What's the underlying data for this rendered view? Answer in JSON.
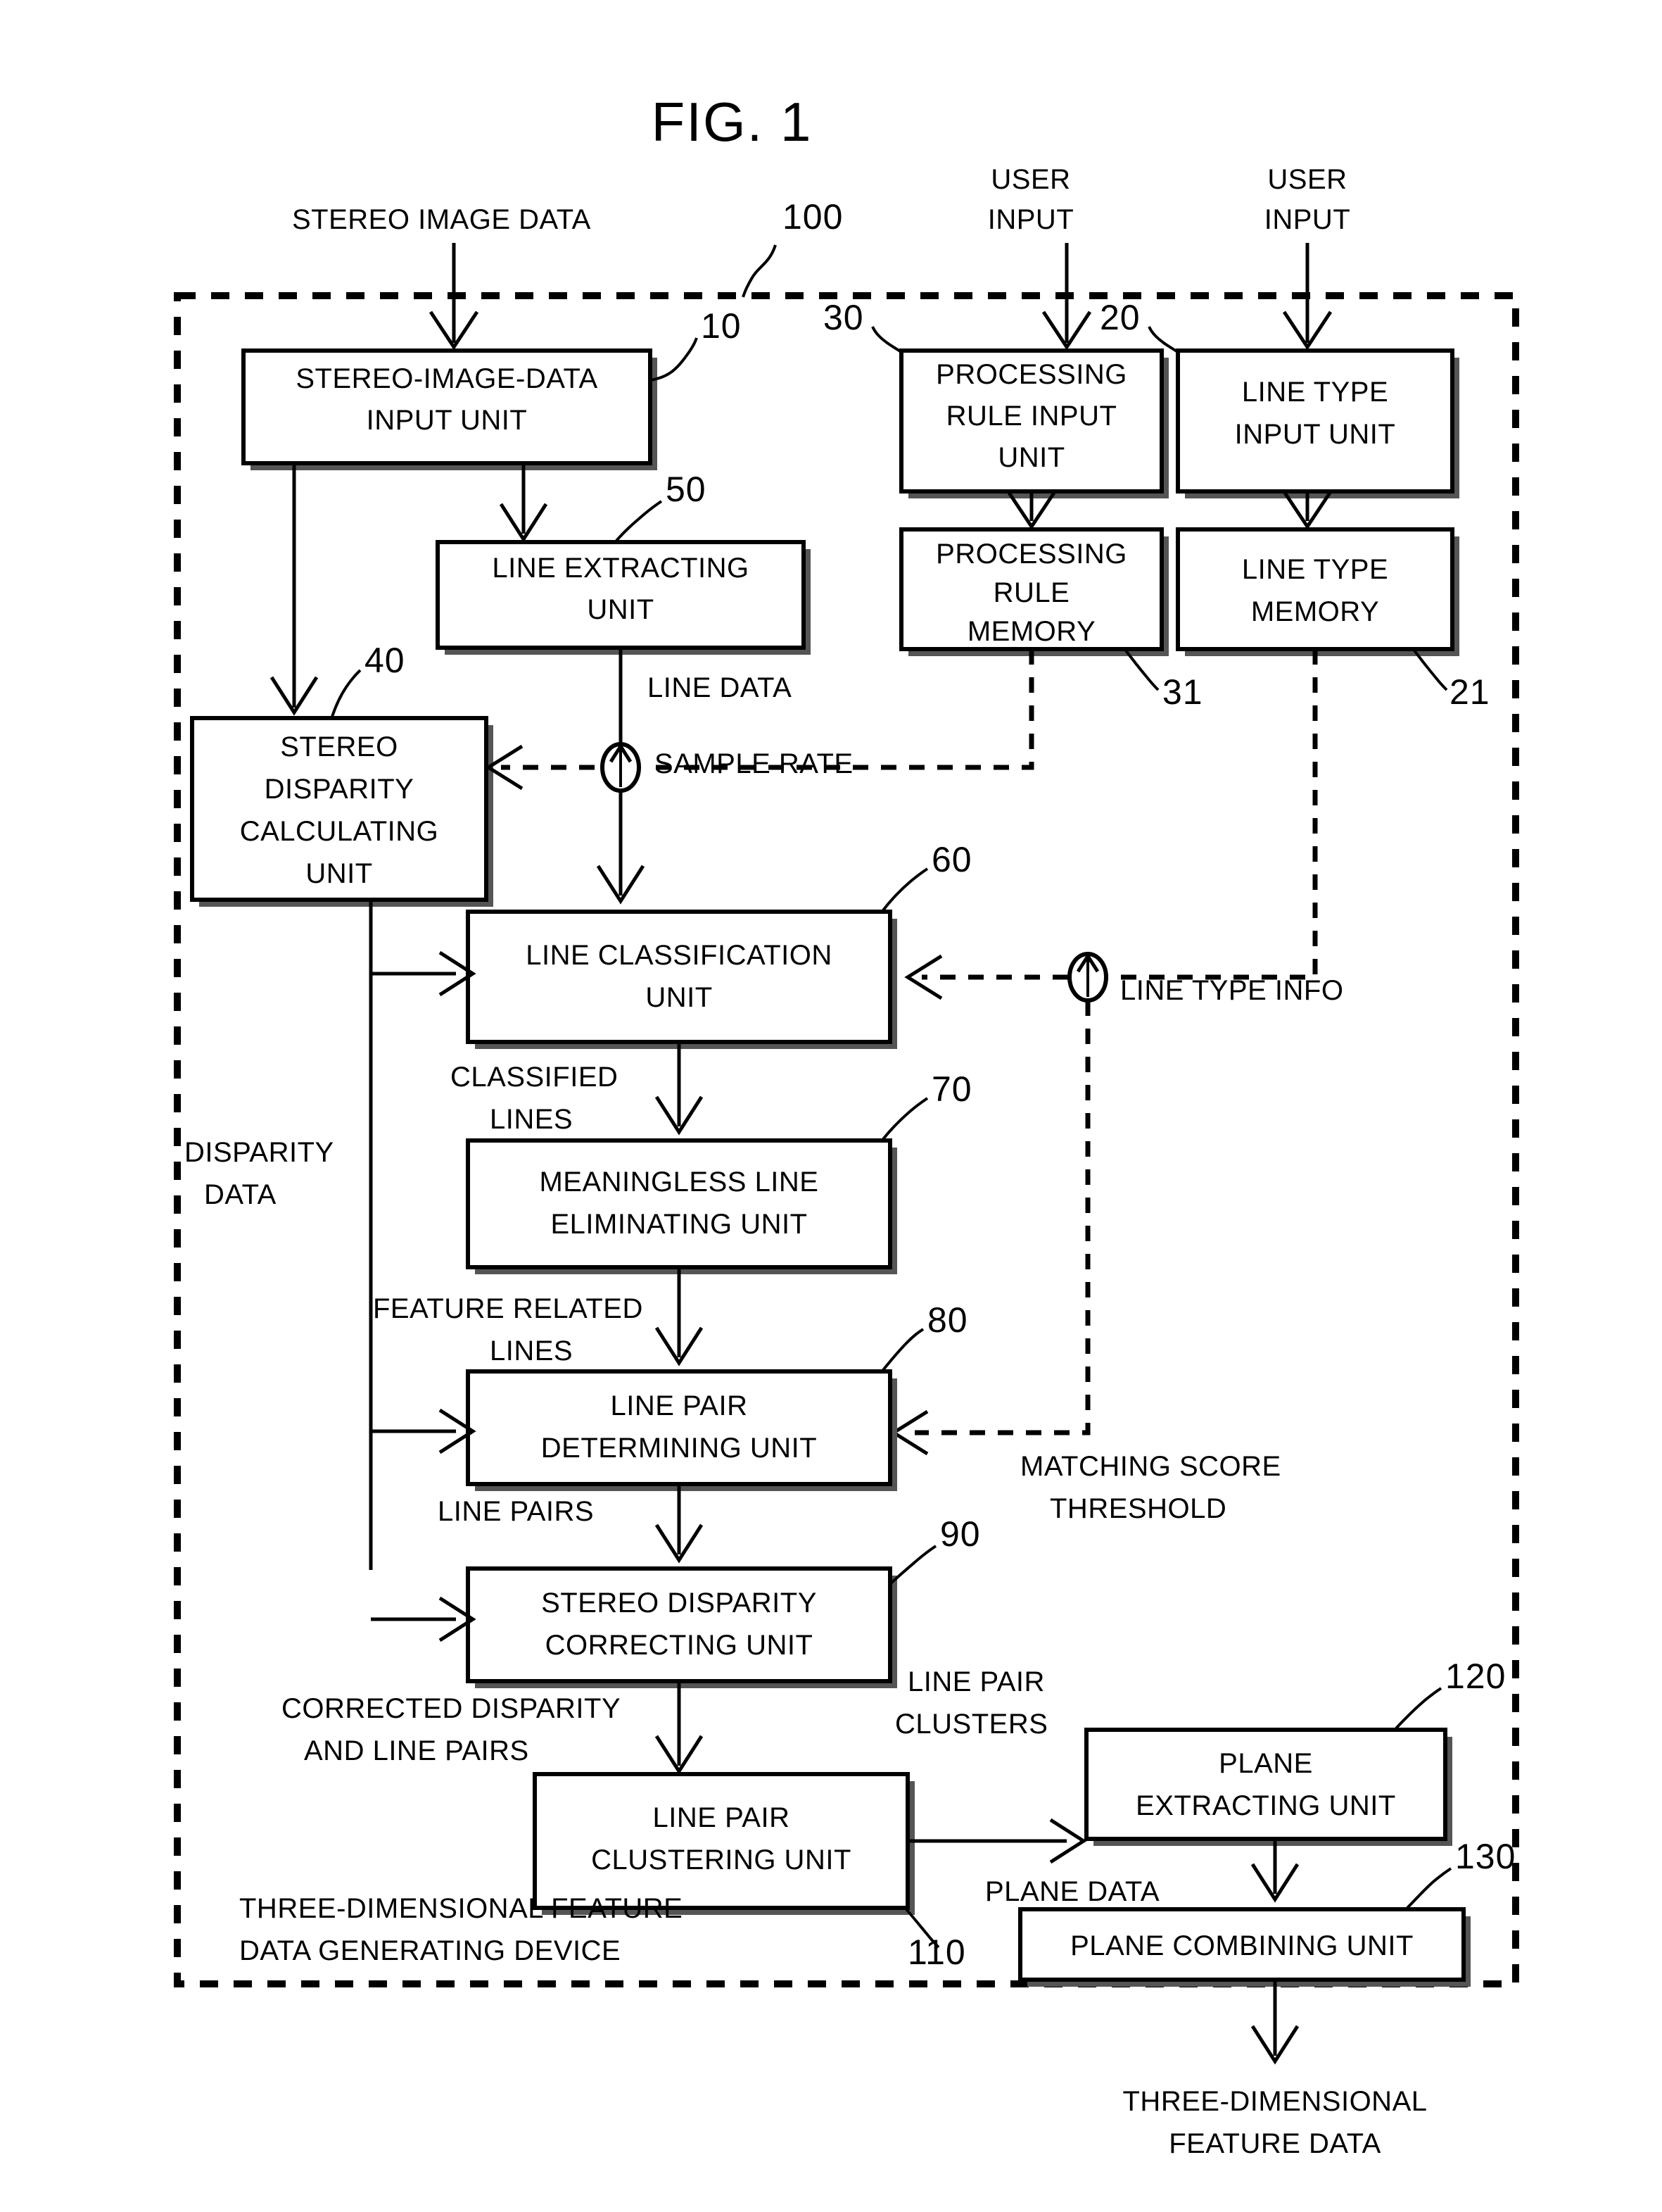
{
  "figure": {
    "title": "FIG. 1",
    "device_label_line1": "THREE-DIMENSIONAL FEATURE",
    "device_label_line2": "DATA GENERATING DEVICE",
    "device_ref": "100"
  },
  "external_inputs": [
    {
      "name": "stereo-image-data-input",
      "label": "STEREO IMAGE DATA"
    },
    {
      "name": "user-input-processing-rule",
      "label_line1": "USER",
      "label_line2": "INPUT"
    },
    {
      "name": "user-input-line-type",
      "label_line1": "USER",
      "label_line2": "INPUT"
    }
  ],
  "external_output": {
    "label_line1": "THREE-DIMENSIONAL",
    "label_line2": "FEATURE DATA"
  },
  "boxes": [
    {
      "id": "stereo_image_data_input_unit",
      "ref": "10",
      "line1": "STEREO-IMAGE-DATA",
      "line2": "INPUT UNIT"
    },
    {
      "id": "processing_rule_input_unit",
      "ref": "30",
      "line1": "PROCESSING",
      "line2": "RULE INPUT",
      "line3": "UNIT"
    },
    {
      "id": "line_type_input_unit",
      "ref": "20",
      "line1": "LINE TYPE",
      "line2": "INPUT UNIT"
    },
    {
      "id": "line_extracting_unit",
      "ref": "50",
      "line1": "LINE EXTRACTING",
      "line2": "UNIT"
    },
    {
      "id": "processing_rule_memory",
      "ref": "31",
      "line1": "PROCESSING",
      "line2": "RULE",
      "line3": "MEMORY"
    },
    {
      "id": "line_type_memory",
      "ref": "21",
      "line1": "LINE TYPE",
      "line2": "MEMORY"
    },
    {
      "id": "stereo_disparity_calculating_unit",
      "ref": "40",
      "line1": "STEREO",
      "line2": "DISPARITY",
      "line3": "CALCULATING",
      "line4": "UNIT"
    },
    {
      "id": "line_classification_unit",
      "ref": "60",
      "line1": "LINE CLASSIFICATION",
      "line2": "UNIT"
    },
    {
      "id": "meaningless_line_eliminating_unit",
      "ref": "70",
      "line1": "MEANINGLESS LINE",
      "line2": "ELIMINATING UNIT"
    },
    {
      "id": "line_pair_determining_unit",
      "ref": "80",
      "line1": "LINE PAIR",
      "line2": "DETERMINING UNIT"
    },
    {
      "id": "stereo_disparity_correcting_unit",
      "ref": "90",
      "line1": "STEREO DISPARITY",
      "line2": "CORRECTING UNIT"
    },
    {
      "id": "line_pair_clustering_unit",
      "ref": "110",
      "line1": "LINE PAIR",
      "line2": "CLUSTERING UNIT"
    },
    {
      "id": "plane_extracting_unit",
      "ref": "120",
      "line1": "PLANE",
      "line2": "EXTRACTING UNIT"
    },
    {
      "id": "plane_combining_unit",
      "ref": "130",
      "line1": "PLANE COMBINING UNIT"
    }
  ],
  "flow_labels": {
    "line_data": "LINE DATA",
    "sample_rate": "SAMPLE RATE",
    "line_type_info": "LINE TYPE INFO",
    "disparity_data_l1": "DISPARITY",
    "disparity_data_l2": "DATA",
    "classified_lines_l1": "CLASSIFIED",
    "classified_lines_l2": "LINES",
    "feature_related_lines_l1": "FEATURE RELATED",
    "feature_related_lines_l2": "LINES",
    "line_pairs": "LINE PAIRS",
    "matching_score_threshold_l1": "MATCHING SCORE",
    "matching_score_threshold_l2": "THRESHOLD",
    "corrected_disparity_l1": "CORRECTED DISPARITY",
    "corrected_disparity_l2": "AND LINE PAIRS",
    "line_pair_clusters_l1": "LINE PAIR",
    "line_pair_clusters_l2": "CLUSTERS",
    "plane_data": "PLANE DATA"
  },
  "colors": {
    "ink": "#000000",
    "paper": "#ffffff",
    "shadow": "#555555"
  }
}
